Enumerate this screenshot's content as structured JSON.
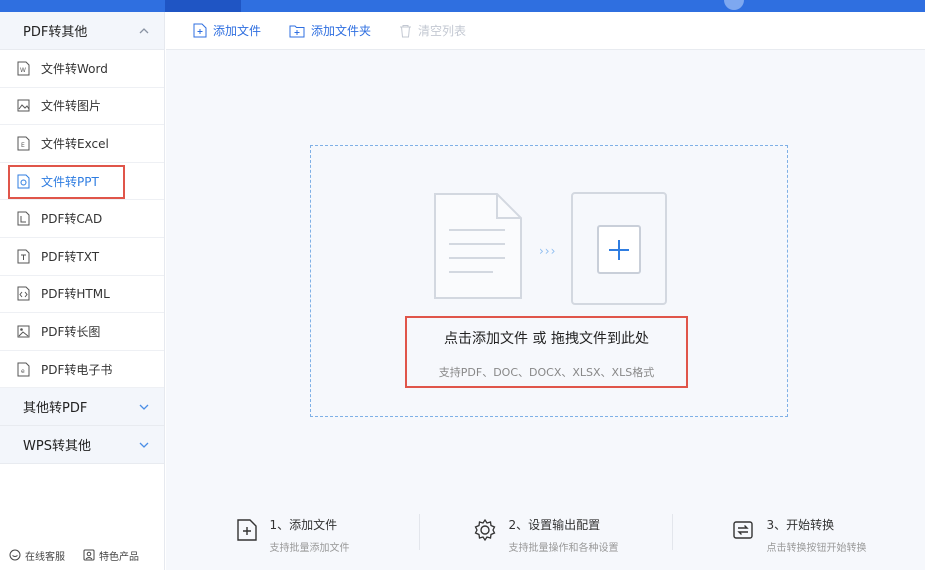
{
  "sidebar": {
    "group_pdf_to_other": "PDF转其他",
    "items": [
      {
        "label": "文件转Word",
        "icon": "word-file-icon"
      },
      {
        "label": "文件转图片",
        "icon": "image-file-icon"
      },
      {
        "label": "文件转Excel",
        "icon": "excel-file-icon"
      },
      {
        "label": "文件转PPT",
        "icon": "ppt-file-icon",
        "active": true
      },
      {
        "label": "PDF转CAD",
        "icon": "cad-file-icon"
      },
      {
        "label": "PDF转TXT",
        "icon": "txt-file-icon"
      },
      {
        "label": "PDF转HTML",
        "icon": "html-file-icon"
      },
      {
        "label": "PDF转长图",
        "icon": "long-image-icon"
      },
      {
        "label": "PDF转电子书",
        "icon": "ebook-file-icon"
      }
    ],
    "group_other_to_pdf": "其他转PDF",
    "group_wps_to_other": "WPS转其他",
    "footer": {
      "online_service": "在线客服",
      "featured_products": "特色产品"
    }
  },
  "toolbar": {
    "add_file": "添加文件",
    "add_folder": "添加文件夹",
    "clear_list": "清空列表"
  },
  "dropzone": {
    "title": "点击添加文件 或 拖拽文件到此处",
    "formats": "支持PDF、DOC、DOCX、XLSX、XLS格式"
  },
  "steps": [
    {
      "title": "1、添加文件",
      "desc": "支持批量添加文件",
      "icon": "add-file-icon"
    },
    {
      "title": "2、设置输出配置",
      "desc": "支持批量操作和各种设置",
      "icon": "gear-icon"
    },
    {
      "title": "3、开始转换",
      "desc": "点击转换按钮开始转换",
      "icon": "convert-icon"
    }
  ],
  "colors": {
    "accent": "#2f6fe0",
    "highlight": "#e0554a",
    "active_text": "#2f7de1"
  }
}
